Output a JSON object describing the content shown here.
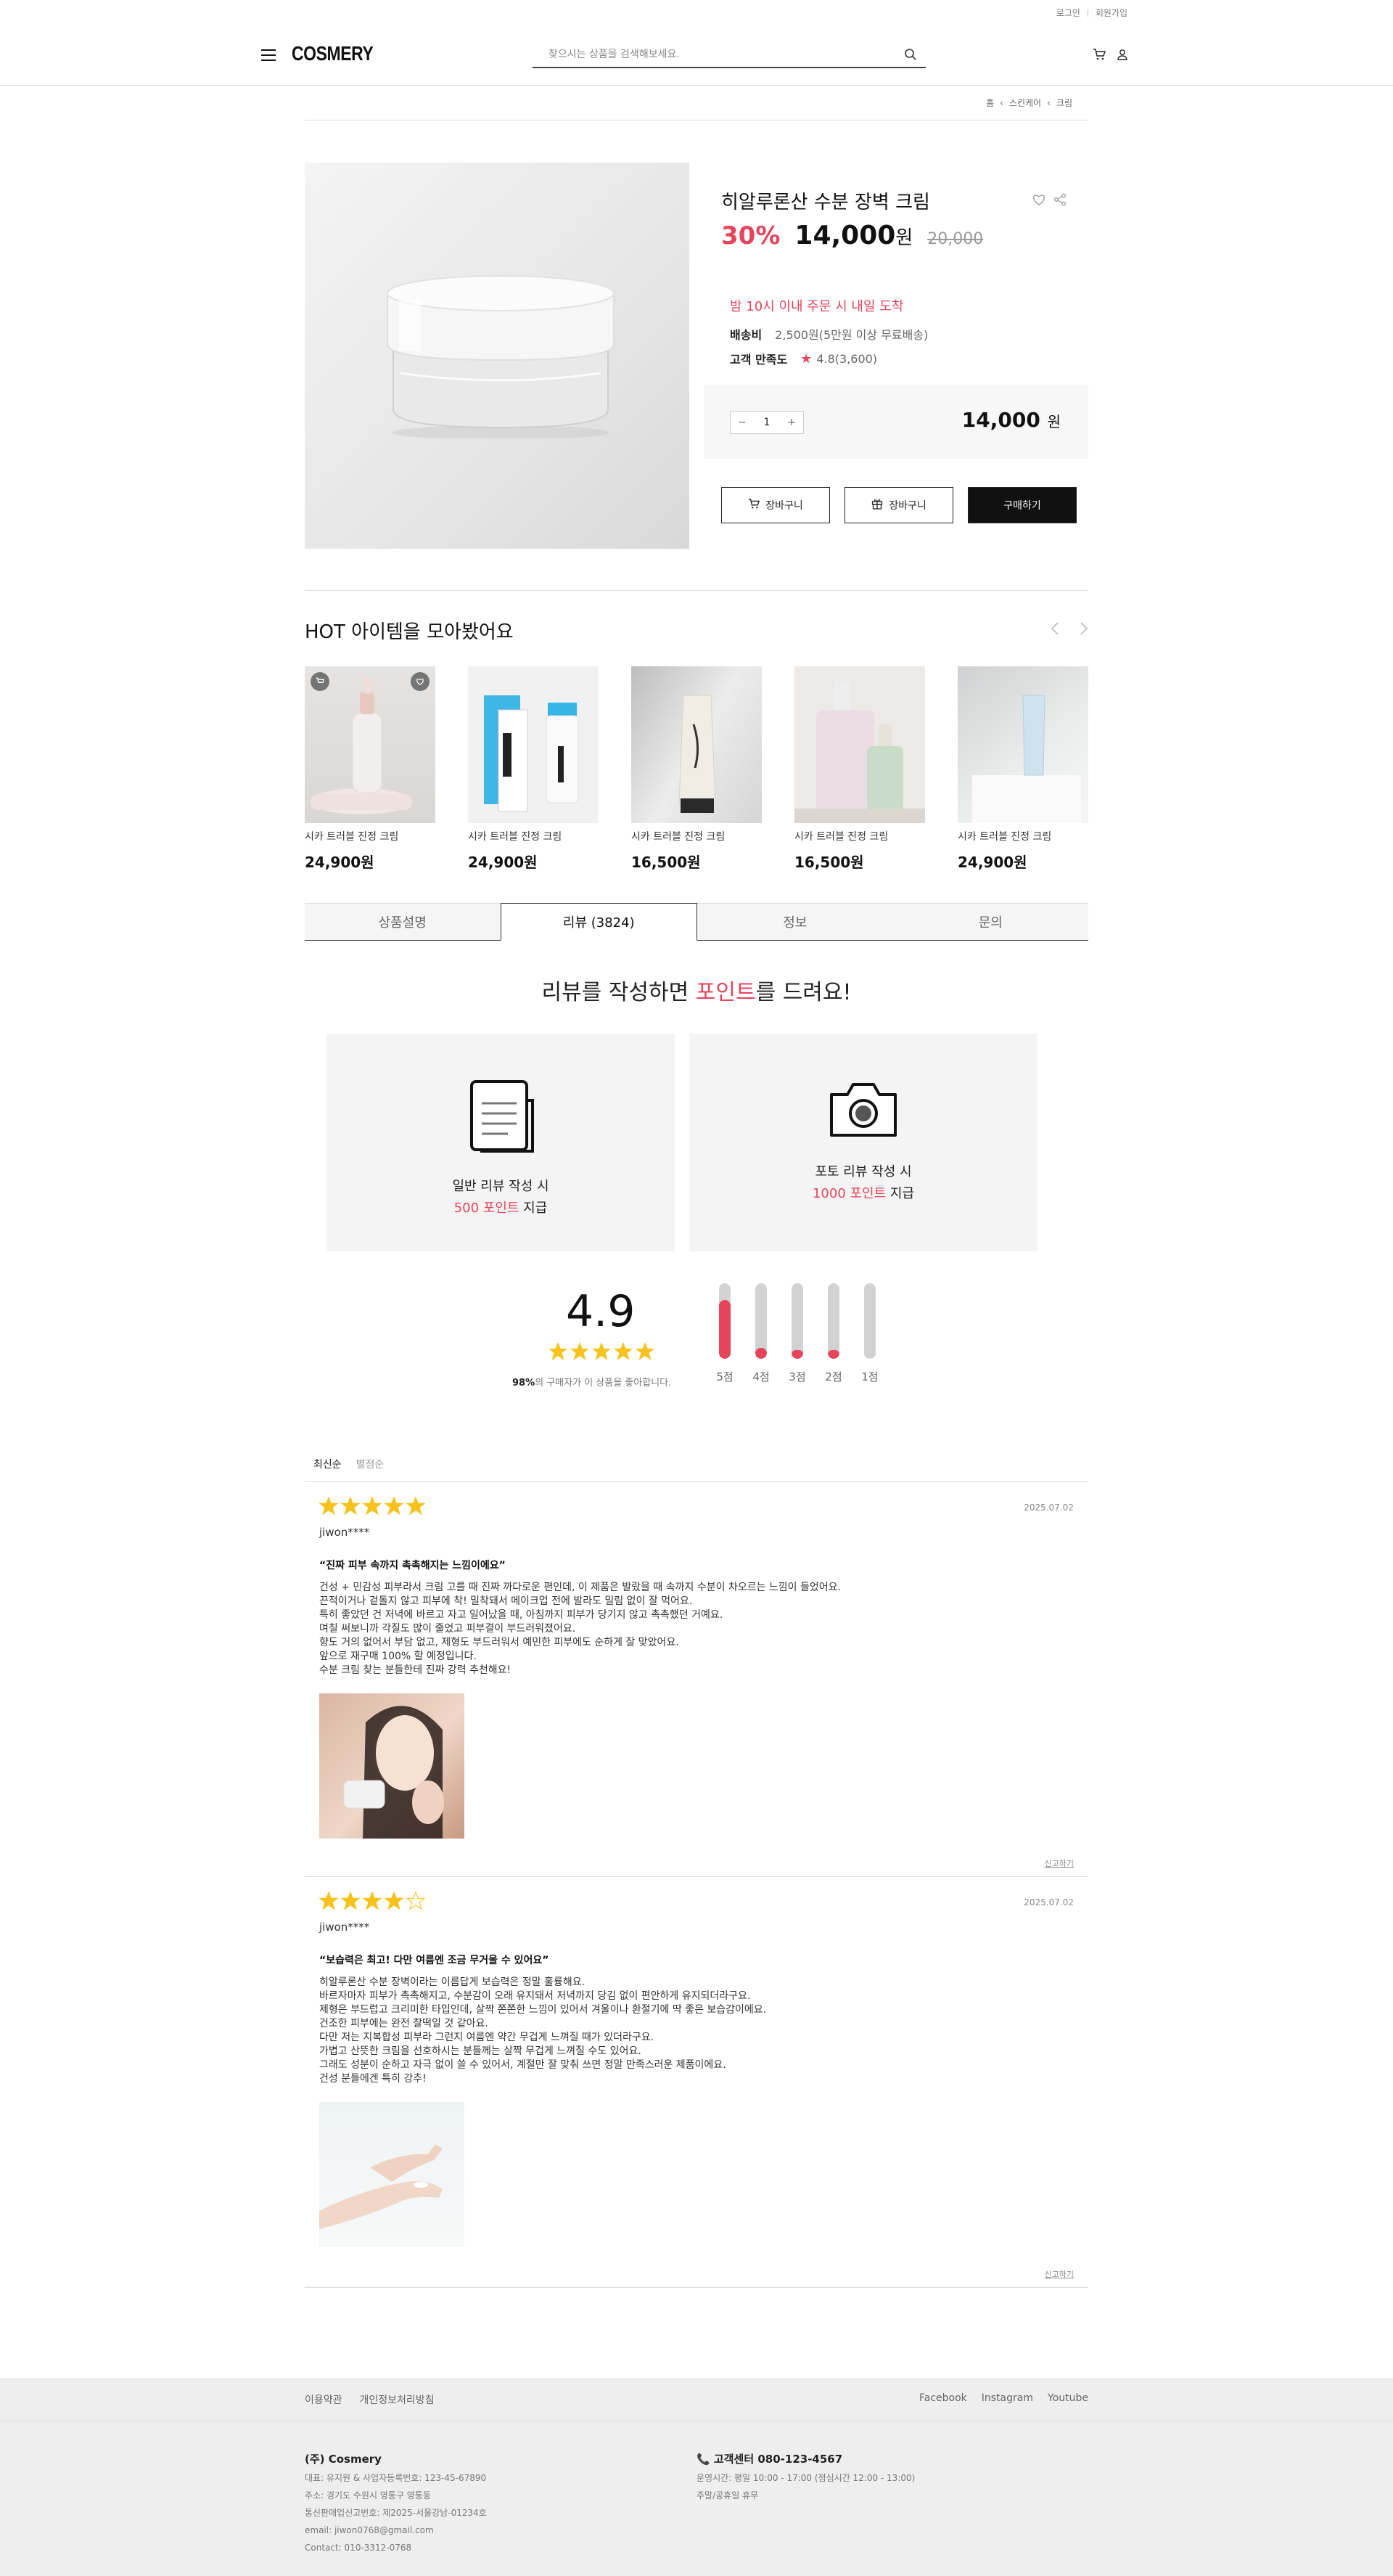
{
  "util": {
    "login": "로그인",
    "signup": "회원가입"
  },
  "header": {
    "logo": "COSMERY",
    "search_placeholder": "찾으시는 상품을 검색해보세요."
  },
  "breadcrumb": [
    "홈",
    "스킨케어",
    "크림"
  ],
  "product": {
    "title": "히알루론산 수분 장벽 크림",
    "discount": "30%",
    "price": "14,000",
    "currency": "원",
    "original_price": "20,000",
    "delivery_notice": "밤 10시 이내 주문 시 내일 도착",
    "shipping_label": "배송비",
    "shipping_value": "2,500원(5만원 이상 무료배송)",
    "satisfaction_label": "고객 만족도",
    "satisfaction_value": "4.8(3,600)",
    "quantity": "1",
    "total": "14,000",
    "buttons": {
      "cart": "장바구니",
      "gift": "장바구니",
      "buy": "구매하기"
    }
  },
  "hot": {
    "title": "HOT 아이템을 모아봤어요",
    "items": [
      {
        "name": "시카 트러블 진정 크림",
        "price": "24,900원"
      },
      {
        "name": "시카 트러블 진정 크림",
        "price": "24,900원"
      },
      {
        "name": "시카 트러블 진정 크림",
        "price": "16,500원"
      },
      {
        "name": "시카 트러블 진정 크림",
        "price": "16,500원"
      },
      {
        "name": "시카 트러블 진정 크림",
        "price": "24,900원"
      }
    ]
  },
  "tabs": [
    "상품설명",
    "리뷰 (3824)",
    "정보",
    "문의"
  ],
  "promo": {
    "title_a": "리뷰를 작성하면 ",
    "title_hl": "포인트",
    "title_b": "를 드려요!",
    "cards": [
      {
        "line1": "일반 리뷰 작성 시",
        "points": "500 포인트",
        "suffix": " 지급"
      },
      {
        "line1": "포토 리뷰 작성 시",
        "points": "1000 포인트",
        "suffix": " 지급"
      }
    ]
  },
  "rating": {
    "score": "4.9",
    "percent": "98%",
    "percent_text": "의 구매자가 이 상품을 좋아합니다.",
    "bars": [
      {
        "label": "5점",
        "fill": 0.78
      },
      {
        "label": "4점",
        "fill": 0.14
      },
      {
        "label": "3점",
        "fill": 0.12
      },
      {
        "label": "2점",
        "fill": 0.12
      },
      {
        "label": "1점",
        "fill": 0
      }
    ]
  },
  "sort": {
    "latest": "최신순",
    "rating": "별점순"
  },
  "reviews": [
    {
      "stars": 5,
      "date": "2025.07.02",
      "user": "jiwon****",
      "headline": "“진짜 피부 속까지 촉촉해지는 느낌이에요”",
      "body": "건성 + 민감성 피부라서 크림 고를 때 진짜 까다로운 편인데, 이 제품은 발랐을 때 속까지 수분이 차오르는 느낌이 들었어요.\n 끈적이거나 겉돌지 않고 피부에 착! 밀착돼서 메이크업 전에 발라도 밀림 없이 잘 먹어요.\n특히 좋았던 건 저녁에 바르고 자고 일어났을 때, 아침까지 피부가 당기지 않고 촉촉했던 거예요.\n 며칠 써보니까 각질도 많이 줄었고 피부결이 부드러워졌어요.\n향도 거의 없어서 부담 없고, 제형도 부드러워서 예민한 피부에도 순하게 잘 맞았어요.\n 앞으로 재구매 100% 할 예정입니다.\n 수분 크림 찾는 분들한테 진짜 강력 추천해요!",
      "report": "신고하기"
    },
    {
      "stars": 4,
      "date": "2025.07.02",
      "user": "jiwon****",
      "headline": "“보습력은 최고! 다만 여름엔 조금 무거울 수 있어요”",
      "body": "히알루론산 수분 장벽이라는 이름답게 보습력은 정말 훌륭해요.\n 바르자마자 피부가 촉촉해지고, 수분감이 오래 유지돼서 저녁까지 당김 없이 편안하게 유지되더라구요.\n제형은 부드럽고 크리미한 타입인데, 살짝 쫀쫀한 느낌이 있어서 겨울이나 환절기에 딱 좋은 보습감이에요.\n건조한 피부에는 완전 찰떡일 것 같아요.\n다만 저는 지복합성 피부라 그런지 여름엔 약간 무겁게 느껴질 때가 있더라구요.\n 가볍고 산뜻한 크림을 선호하시는 분들께는 살짝 무겁게 느껴질 수도 있어요.\n그래도 성분이 순하고 자극 없이 쓸 수 있어서, 계절만 잘 맞춰 쓰면 정말 만족스러운 제품이에요.\n 건성 분들에겐 특히 강추!",
      "report": "신고하기"
    }
  ],
  "footer": {
    "links_left": [
      "이용약관",
      "개인정보처리방침"
    ],
    "links_right": [
      "Facebook",
      "Instagram",
      "Youtube"
    ],
    "company": "(주) Cosmery",
    "info": [
      "대표: 유지원 & 사업자등록번호: 123-45-67890",
      "주소: 경기도 수원시 영통구 영통동",
      "통신판매업신고번호: 제2025-서울강남-01234호",
      "email: jiwon0768@gmail.com",
      "Contact: 010-3312-0768"
    ],
    "cs_title": "고객센터 080-123-4567",
    "cs_info": [
      "운영시간: 평일 10:00 - 17:00 (점심시간 12:00 - 13:00)",
      "주말/공휴일 휴무"
    ]
  }
}
